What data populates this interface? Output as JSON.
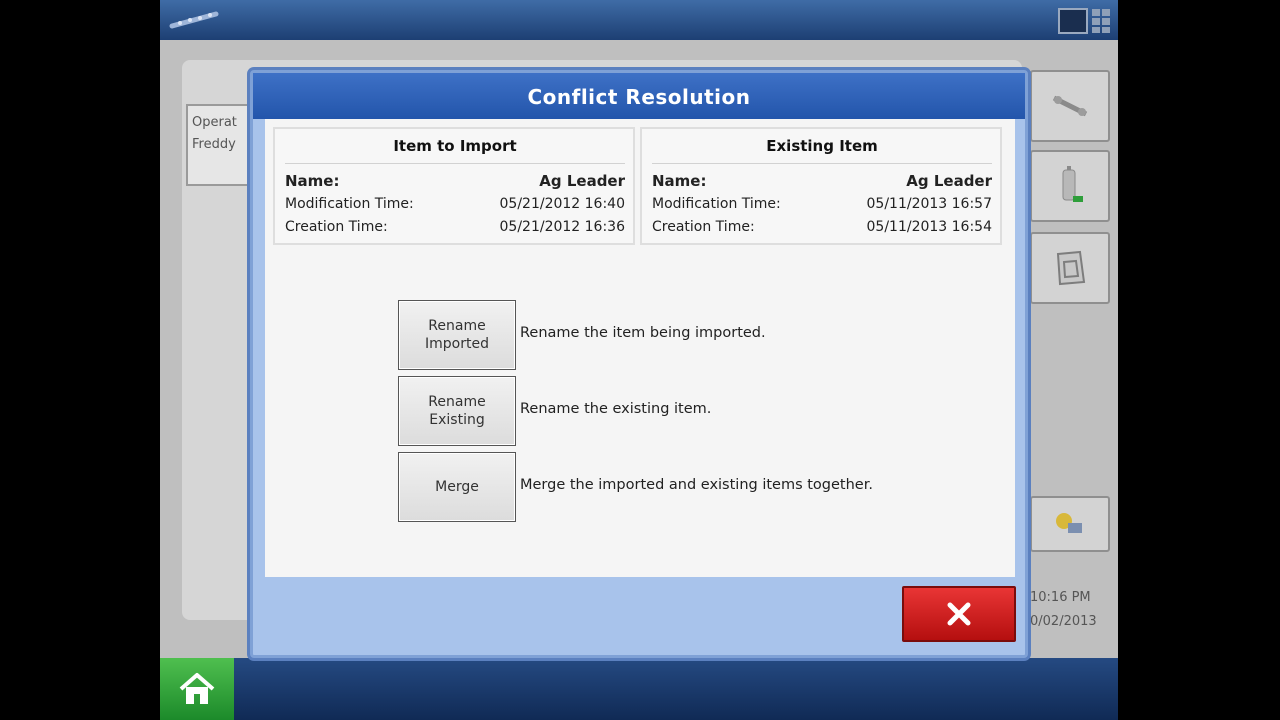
{
  "background": {
    "operator_label": "Operat",
    "operator_value": "Freddy",
    "clock_time": "10:16 PM",
    "clock_date": "0/02/2013"
  },
  "dialog": {
    "title": "Conflict Resolution",
    "import_item": {
      "header": "Item to Import",
      "name_label": "Name:",
      "name_value": "Ag Leader",
      "mod_label": "Modification Time:",
      "mod_value": "05/21/2012 16:40",
      "created_label": "Creation Time:",
      "created_value": "05/21/2012 16:36"
    },
    "existing_item": {
      "header": "Existing Item",
      "name_label": "Name:",
      "name_value": "Ag Leader",
      "mod_label": "Modification Time:",
      "mod_value": "05/11/2013 16:57",
      "created_label": "Creation Time:",
      "created_value": "05/11/2013 16:54"
    },
    "actions": [
      {
        "label": "Rename\nImported",
        "description": "Rename the item being imported."
      },
      {
        "label": "Rename\nExisting",
        "description": "Rename the existing item."
      },
      {
        "label": "Merge",
        "description": "Merge the imported and existing items together."
      }
    ],
    "close_icon": "close-x-icon"
  },
  "colors": {
    "title_bar": "#2f62b8",
    "dialog_frame": "#a8c3eb",
    "close_button": "#d42020",
    "home_button": "#2e9e3a"
  }
}
